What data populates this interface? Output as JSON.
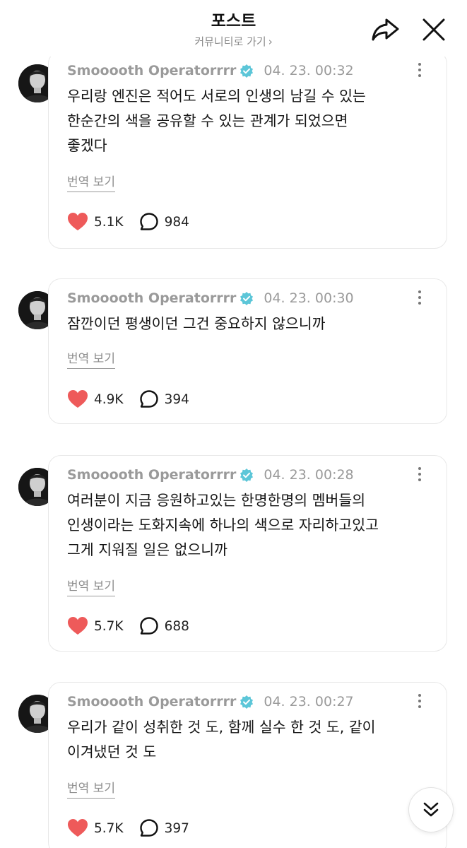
{
  "header": {
    "title": "포스트",
    "community_link": "커뮤니티로 가기",
    "chevron": "›"
  },
  "colors": {
    "like": "#ee5a5a",
    "verified": "#5cc6d8",
    "muted": "#9a9a9a"
  },
  "icons": [
    "share-icon",
    "close-icon",
    "verified-icon",
    "more-icon",
    "heart-icon",
    "comment-icon",
    "scroll-down-icon"
  ],
  "posts": [
    {
      "author": "Smooooth Operatorrrr",
      "time": "04. 23. 00:32",
      "lines": [
        "우리랑 엔진은 적어도 서로의 인생의 남길 수 있는",
        "한순간의 색을 공유할 수 있는 관계가 되었으면",
        "좋겠다"
      ],
      "translate": "번역 보기",
      "likes": "5.1K",
      "comments": "984"
    },
    {
      "author": "Smooooth Operatorrrr",
      "time": "04. 23. 00:30",
      "lines": [
        "잠깐이던 평생이던 그건 중요하지 않으니까"
      ],
      "translate": "번역 보기",
      "likes": "4.9K",
      "comments": "394"
    },
    {
      "author": "Smooooth Operatorrrr",
      "time": "04. 23. 00:28",
      "lines": [
        "여러분이 지금 응원하고있는 한명한명의 멤버들의",
        "인생이라는 도화지속에 하나의 색으로 자리하고있고",
        "그게 지워질 일은 없으니까"
      ],
      "translate": "번역 보기",
      "likes": "5.7K",
      "comments": "688"
    },
    {
      "author": "Smooooth Operatorrrr",
      "time": "04. 23. 00:27",
      "lines": [
        "우리가 같이 성취한 것 도, 함께 실수 한 것 도, 같이",
        "이겨냈던 것 도"
      ],
      "translate": "번역 보기",
      "likes": "5.7K",
      "comments": "397"
    }
  ]
}
